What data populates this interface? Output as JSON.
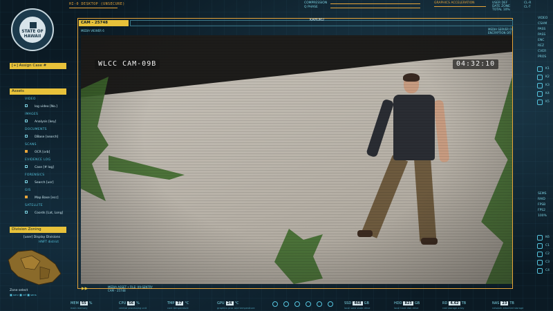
{
  "topbar": {
    "title": "HI-0 DESKTOP (UNSECURE)",
    "compression": "COMPRESSION",
    "q_phase": "Q PHASE",
    "graphics": "GRAPHICS ACCELERATION",
    "user_def": "USER DEF",
    "date_zone": "DATE ZONE",
    "total": "TOTAL 10%",
    "cl_r": "CL-R",
    "cl_t": "CL-T"
  },
  "seal": {
    "line1": "STATE OF",
    "line2": "HAWAII"
  },
  "case": {
    "assign_label": "[+] Assign Case #"
  },
  "assets": {
    "header": "Assets",
    "groups": [
      {
        "category": "VIDEO",
        "item": "log video [No.]"
      },
      {
        "category": "IMAGES",
        "item": "Analysis [key]"
      },
      {
        "category": "DOCUMENTS",
        "item": "DBase [search]"
      },
      {
        "category": "SCANS",
        "item": "OCR [orb]"
      },
      {
        "category": "EVIDENCE LOG",
        "item": "Case [# log]"
      },
      {
        "category": "FORENSICS",
        "item": "Search [usr]"
      },
      {
        "category": "GIS",
        "item": "Map Base [ecc]"
      },
      {
        "category": "SATELLITE",
        "item": "Coords [Lat, Long]"
      }
    ]
  },
  "zoning": {
    "header": "Division Zoning",
    "display": "[user] Display Divisions",
    "sub": "HNFT district",
    "zone_select": "Zone select",
    "zone_opts": "■ serv  ■ ref  ■ sens"
  },
  "camera": {
    "header": "CAM - 25748",
    "media_viewer": "MEDIA VIEWER 6",
    "media_server": "MEDIA SERVER 01",
    "encryption": "ENCRYPTION OFF",
    "location": "KAHUKU",
    "osd_name": "WLCC CAM-09B",
    "osd_time": "04:32:10",
    "footer_asset": "MEDIA ASSET • FILE: 09-SENTRY",
    "footer_cam": "CAM - 25748"
  },
  "right_rail": {
    "labels": [
      "VIDEO",
      "CSHM",
      "PASS",
      "PASS",
      "ENC",
      "REZ",
      "CVER",
      "PROS"
    ],
    "lower_labels": [
      "SEMS",
      "RAID",
      "FPSB",
      "FPS2",
      "100%"
    ],
    "numbers": [
      "K1",
      "K2",
      "K3",
      "K4",
      "K5",
      "K6",
      "C1",
      "C2",
      "C3",
      "C4"
    ]
  },
  "status": [
    {
      "label": "MEM",
      "value": "55",
      "unit": "%",
      "sub": "main memory"
    },
    {
      "label": "CPU",
      "value": "56",
      "unit": "%",
      "sub": "central processing unit"
    },
    {
      "label": "TMP",
      "value": "37",
      "unit": "°C",
      "sub": "core temperature"
    },
    {
      "label": "GPU",
      "value": "24",
      "unit": "°C",
      "sub": "graphics proc and temperature"
    },
    {
      "label": "SSD",
      "value": "468",
      "unit": "GB",
      "sub": "local solid state drive"
    },
    {
      "label": "HDD",
      "value": "823",
      "unit": "GB",
      "sub": "local hard disk drive"
    },
    {
      "label": "RD",
      "value": "4.62",
      "unit": "TB",
      "sub": "raid storage array"
    },
    {
      "label": "NAS",
      "value": "23",
      "unit": "TB",
      "sub": "network attached storage"
    }
  ],
  "status_icons": [
    "bluetooth-icon",
    "power-icon",
    "wifi-icon",
    "lan-icon",
    "usb-icon",
    "sd-icon"
  ],
  "status_icon_labels": [
    "BT",
    "PWR",
    "WIFI",
    "LAN",
    "USB",
    "SD"
  ],
  "colors": {
    "accent_orange": "#e8a53a",
    "accent_yellow": "#e8c23a",
    "cyan": "#7fd6e6",
    "background": "#0b1a24"
  }
}
